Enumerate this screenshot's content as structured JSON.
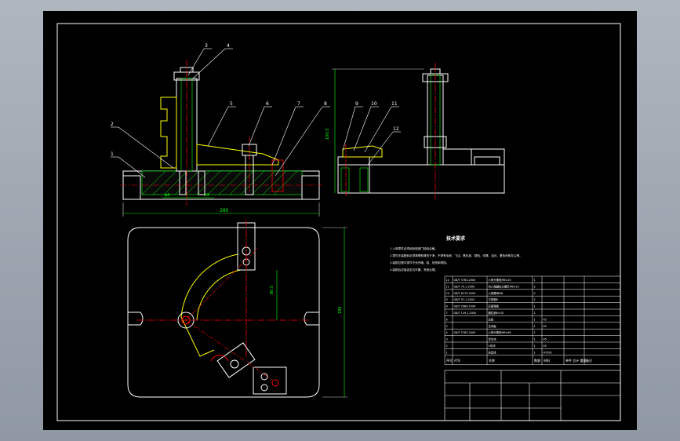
{
  "drawing": {
    "tech_title": "技术要求",
    "tech_lines": [
      "1.入库零件必须经检验部门检验合格。",
      "2.零件在装配前必须清理和清洗干净，不得有毛刺、飞边、氧化皮、锈蚀、切屑、油污、着色剂和灰尘等。",
      "3.装配过程中零件不允许磕、碰、划伤和锈蚀。",
      "4.装配后应保证定位可靠、夹紧合理。"
    ],
    "balloons": [
      "3",
      "4",
      "5",
      "6",
      "7",
      "8",
      "9",
      "10",
      "11",
      "12",
      "2",
      "1"
    ],
    "dims": {
      "front_width": "280",
      "side_height": "100.5",
      "plan_height": "185",
      "plan_inner": "80.5",
      "small_a": "φ8",
      "small_b": "24"
    },
    "bom": {
      "rows": [
        [
          "12",
          "GB/T 5783-2000",
          "六角头螺栓M6×20",
          "1",
          "",
          "",
          ""
        ],
        [
          "11",
          "GB/T 70.1-2000",
          "内六角圆柱头螺钉M6×25",
          "2",
          "",
          "",
          ""
        ],
        [
          "10",
          "GB/T 6170-2000",
          "六角螺母M8",
          "2",
          "",
          "",
          ""
        ],
        [
          "9",
          "GB/T 97.1-2002",
          "平垫圈8",
          "2",
          "",
          "",
          ""
        ],
        [
          "8",
          "GB/T 2089-1994",
          "压缩弹簧",
          "1",
          "",
          "",
          ""
        ],
        [
          "7",
          "GB/T 119.1-2000",
          "圆柱销6×30",
          "2",
          "",
          "",
          ""
        ],
        [
          "6",
          "",
          "压板",
          "1",
          "45",
          "",
          ""
        ],
        [
          "5",
          "",
          "支承板",
          "1",
          "45",
          "",
          ""
        ],
        [
          "4",
          "GB/T 5782-2000",
          "六角头螺栓M8×60",
          "1",
          "",
          "",
          ""
        ],
        [
          "3",
          "",
          "定位块",
          "1",
          "45",
          "",
          ""
        ],
        [
          "2",
          "",
          "V形块",
          "1",
          "45",
          "",
          ""
        ],
        [
          "1",
          "",
          "夹具体",
          "1",
          "HT200",
          "",
          ""
        ]
      ],
      "header": [
        "序号",
        "代号",
        "名称",
        "数量",
        "材料",
        "单件 总计 重量",
        "备注"
      ]
    }
  }
}
